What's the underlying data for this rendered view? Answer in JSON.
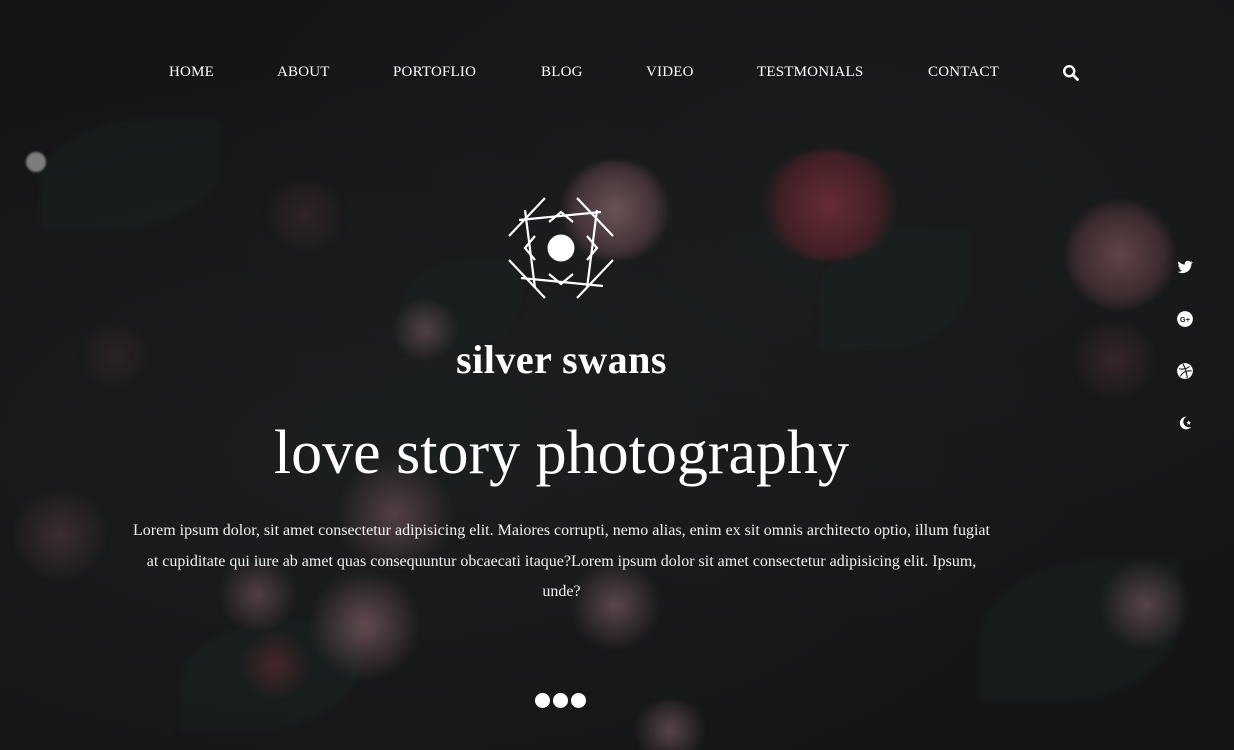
{
  "nav": {
    "items": [
      {
        "label": "HOME"
      },
      {
        "label": "ABOUT"
      },
      {
        "label": "PORTOFLIO"
      },
      {
        "label": "BLOG"
      },
      {
        "label": "VIDEO"
      },
      {
        "label": "TESTMONIALS"
      },
      {
        "label": "CONTACT"
      }
    ],
    "search_icon": "search-icon"
  },
  "hero": {
    "logo_icon": "geometric-diamond-logo",
    "brand": "silver swans",
    "headline": "love story photography",
    "intro": "Lorem ipsum dolor, sit amet consectetur adipisicing elit. Maiores corrupti, nemo alias, enim ex sit omnis architecto optio, illum fugiat at cupiditate qui iure ab amet quas consequuntur obcaecati itaque?Lorem ipsum dolor sit amet consectetur adipisicing elit. Ipsum, unde?",
    "carousel_slides": 3
  },
  "social": {
    "icons": [
      "twitter-icon",
      "google-plus-icon",
      "dribbble-icon",
      "other-social-icon"
    ]
  },
  "colors": {
    "background": "#19191b",
    "text": "#ffffff",
    "flower_pink": "#b98a93",
    "flower_red": "#8c3b4a",
    "leaf": "#1e2a26"
  }
}
